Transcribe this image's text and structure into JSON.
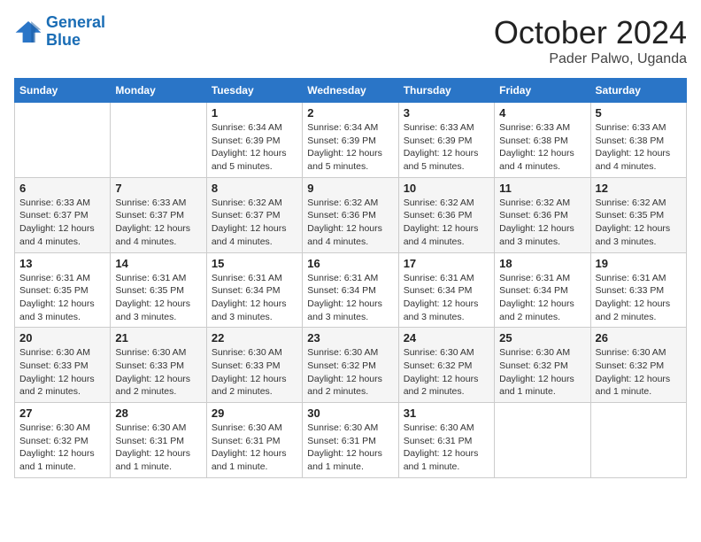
{
  "logo": {
    "line1": "General",
    "line2": "Blue"
  },
  "title": "October 2024",
  "location": "Pader Palwo, Uganda",
  "weekdays": [
    "Sunday",
    "Monday",
    "Tuesday",
    "Wednesday",
    "Thursday",
    "Friday",
    "Saturday"
  ],
  "weeks": [
    [
      {
        "day": "",
        "info": ""
      },
      {
        "day": "",
        "info": ""
      },
      {
        "day": "1",
        "info": "Sunrise: 6:34 AM\nSunset: 6:39 PM\nDaylight: 12 hours\nand 5 minutes."
      },
      {
        "day": "2",
        "info": "Sunrise: 6:34 AM\nSunset: 6:39 PM\nDaylight: 12 hours\nand 5 minutes."
      },
      {
        "day": "3",
        "info": "Sunrise: 6:33 AM\nSunset: 6:39 PM\nDaylight: 12 hours\nand 5 minutes."
      },
      {
        "day": "4",
        "info": "Sunrise: 6:33 AM\nSunset: 6:38 PM\nDaylight: 12 hours\nand 4 minutes."
      },
      {
        "day": "5",
        "info": "Sunrise: 6:33 AM\nSunset: 6:38 PM\nDaylight: 12 hours\nand 4 minutes."
      }
    ],
    [
      {
        "day": "6",
        "info": "Sunrise: 6:33 AM\nSunset: 6:37 PM\nDaylight: 12 hours\nand 4 minutes."
      },
      {
        "day": "7",
        "info": "Sunrise: 6:33 AM\nSunset: 6:37 PM\nDaylight: 12 hours\nand 4 minutes."
      },
      {
        "day": "8",
        "info": "Sunrise: 6:32 AM\nSunset: 6:37 PM\nDaylight: 12 hours\nand 4 minutes."
      },
      {
        "day": "9",
        "info": "Sunrise: 6:32 AM\nSunset: 6:36 PM\nDaylight: 12 hours\nand 4 minutes."
      },
      {
        "day": "10",
        "info": "Sunrise: 6:32 AM\nSunset: 6:36 PM\nDaylight: 12 hours\nand 4 minutes."
      },
      {
        "day": "11",
        "info": "Sunrise: 6:32 AM\nSunset: 6:36 PM\nDaylight: 12 hours\nand 3 minutes."
      },
      {
        "day": "12",
        "info": "Sunrise: 6:32 AM\nSunset: 6:35 PM\nDaylight: 12 hours\nand 3 minutes."
      }
    ],
    [
      {
        "day": "13",
        "info": "Sunrise: 6:31 AM\nSunset: 6:35 PM\nDaylight: 12 hours\nand 3 minutes."
      },
      {
        "day": "14",
        "info": "Sunrise: 6:31 AM\nSunset: 6:35 PM\nDaylight: 12 hours\nand 3 minutes."
      },
      {
        "day": "15",
        "info": "Sunrise: 6:31 AM\nSunset: 6:34 PM\nDaylight: 12 hours\nand 3 minutes."
      },
      {
        "day": "16",
        "info": "Sunrise: 6:31 AM\nSunset: 6:34 PM\nDaylight: 12 hours\nand 3 minutes."
      },
      {
        "day": "17",
        "info": "Sunrise: 6:31 AM\nSunset: 6:34 PM\nDaylight: 12 hours\nand 3 minutes."
      },
      {
        "day": "18",
        "info": "Sunrise: 6:31 AM\nSunset: 6:34 PM\nDaylight: 12 hours\nand 2 minutes."
      },
      {
        "day": "19",
        "info": "Sunrise: 6:31 AM\nSunset: 6:33 PM\nDaylight: 12 hours\nand 2 minutes."
      }
    ],
    [
      {
        "day": "20",
        "info": "Sunrise: 6:30 AM\nSunset: 6:33 PM\nDaylight: 12 hours\nand 2 minutes."
      },
      {
        "day": "21",
        "info": "Sunrise: 6:30 AM\nSunset: 6:33 PM\nDaylight: 12 hours\nand 2 minutes."
      },
      {
        "day": "22",
        "info": "Sunrise: 6:30 AM\nSunset: 6:33 PM\nDaylight: 12 hours\nand 2 minutes."
      },
      {
        "day": "23",
        "info": "Sunrise: 6:30 AM\nSunset: 6:32 PM\nDaylight: 12 hours\nand 2 minutes."
      },
      {
        "day": "24",
        "info": "Sunrise: 6:30 AM\nSunset: 6:32 PM\nDaylight: 12 hours\nand 2 minutes."
      },
      {
        "day": "25",
        "info": "Sunrise: 6:30 AM\nSunset: 6:32 PM\nDaylight: 12 hours\nand 1 minute."
      },
      {
        "day": "26",
        "info": "Sunrise: 6:30 AM\nSunset: 6:32 PM\nDaylight: 12 hours\nand 1 minute."
      }
    ],
    [
      {
        "day": "27",
        "info": "Sunrise: 6:30 AM\nSunset: 6:32 PM\nDaylight: 12 hours\nand 1 minute."
      },
      {
        "day": "28",
        "info": "Sunrise: 6:30 AM\nSunset: 6:31 PM\nDaylight: 12 hours\nand 1 minute."
      },
      {
        "day": "29",
        "info": "Sunrise: 6:30 AM\nSunset: 6:31 PM\nDaylight: 12 hours\nand 1 minute."
      },
      {
        "day": "30",
        "info": "Sunrise: 6:30 AM\nSunset: 6:31 PM\nDaylight: 12 hours\nand 1 minute."
      },
      {
        "day": "31",
        "info": "Sunrise: 6:30 AM\nSunset: 6:31 PM\nDaylight: 12 hours\nand 1 minute."
      },
      {
        "day": "",
        "info": ""
      },
      {
        "day": "",
        "info": ""
      }
    ]
  ]
}
